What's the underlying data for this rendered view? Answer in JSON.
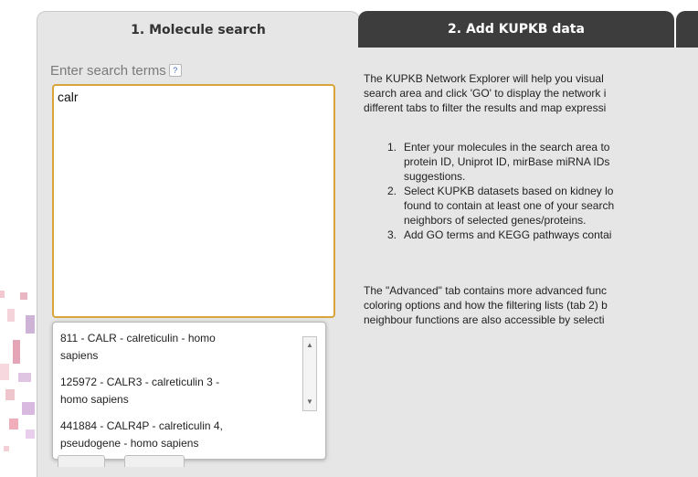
{
  "tabs": [
    {
      "label": "1. Molecule search",
      "active": true
    },
    {
      "label": "2. Add KUPKB data",
      "active": false
    }
  ],
  "search": {
    "label": "Enter search terms",
    "help_icon": "?",
    "value": "calr"
  },
  "suggestions": [
    {
      "line1": "811 - CALR - calreticulin - homo",
      "line2": "sapiens"
    },
    {
      "line1": "125972 - CALR3 - calreticulin 3 -",
      "line2": "homo sapiens"
    },
    {
      "line1": "441884 - CALR4P - calreticulin 4,",
      "line2": "pseudogene - homo sapiens"
    }
  ],
  "description": {
    "intro": [
      "The KUPKB Network Explorer will help you visual",
      "search area and click 'GO' to display the network i",
      "different tabs to filter the results and map expressi"
    ],
    "steps": [
      {
        "num": "1.",
        "lines": [
          "Enter your molecules in the search area to",
          "protein ID, Uniprot ID, mirBase miRNA IDs",
          "suggestions."
        ]
      },
      {
        "num": "2.",
        "lines": [
          "Select KUPKB datasets based on kidney lo",
          "found to contain at least one of your search",
          "neighbors of selected genes/proteins."
        ]
      },
      {
        "num": "3.",
        "lines": [
          "Add GO terms and KEGG pathways contai"
        ]
      }
    ],
    "advanced": [
      "The \"Advanced\" tab contains more advanced func",
      "coloring options and how the filtering lists (tab 2) b",
      "neighbour functions are also accessible by selecti"
    ]
  },
  "colors": {
    "active_tab": "#e6e6e6",
    "inactive_tab": "#3d3d3d",
    "input_border": "#d9a53b"
  }
}
